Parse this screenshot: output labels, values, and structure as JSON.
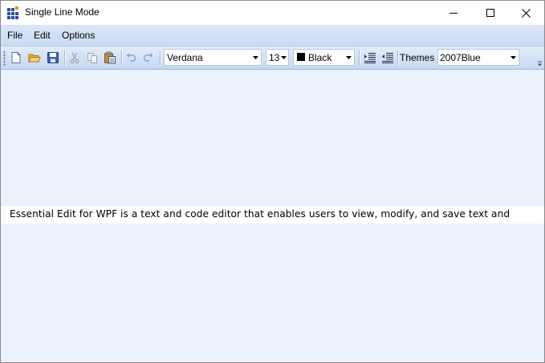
{
  "window": {
    "title": "Single Line Mode"
  },
  "menu": {
    "items": [
      "File",
      "Edit",
      "Options"
    ]
  },
  "toolbar": {
    "buttons": [
      "new-file-icon",
      "open-folder-icon",
      "save-icon",
      "cut-icon",
      "copy-icon",
      "paste-icon",
      "undo-icon",
      "redo-icon",
      "indent-icon",
      "outdent-icon"
    ],
    "font_family": "Verdana",
    "font_size": "13",
    "font_color": {
      "label": "Black",
      "value": "#000000"
    },
    "themes_label": "Themes :",
    "theme": "2007Blue"
  },
  "editor": {
    "text": "Essential Edit for WPF is a text and code editor that enables users to view, modify, and save text and"
  },
  "colors": {
    "accent": "#2b4f9e",
    "menubar": "#d3e1f5",
    "editor_background": "#eaf1fb"
  }
}
